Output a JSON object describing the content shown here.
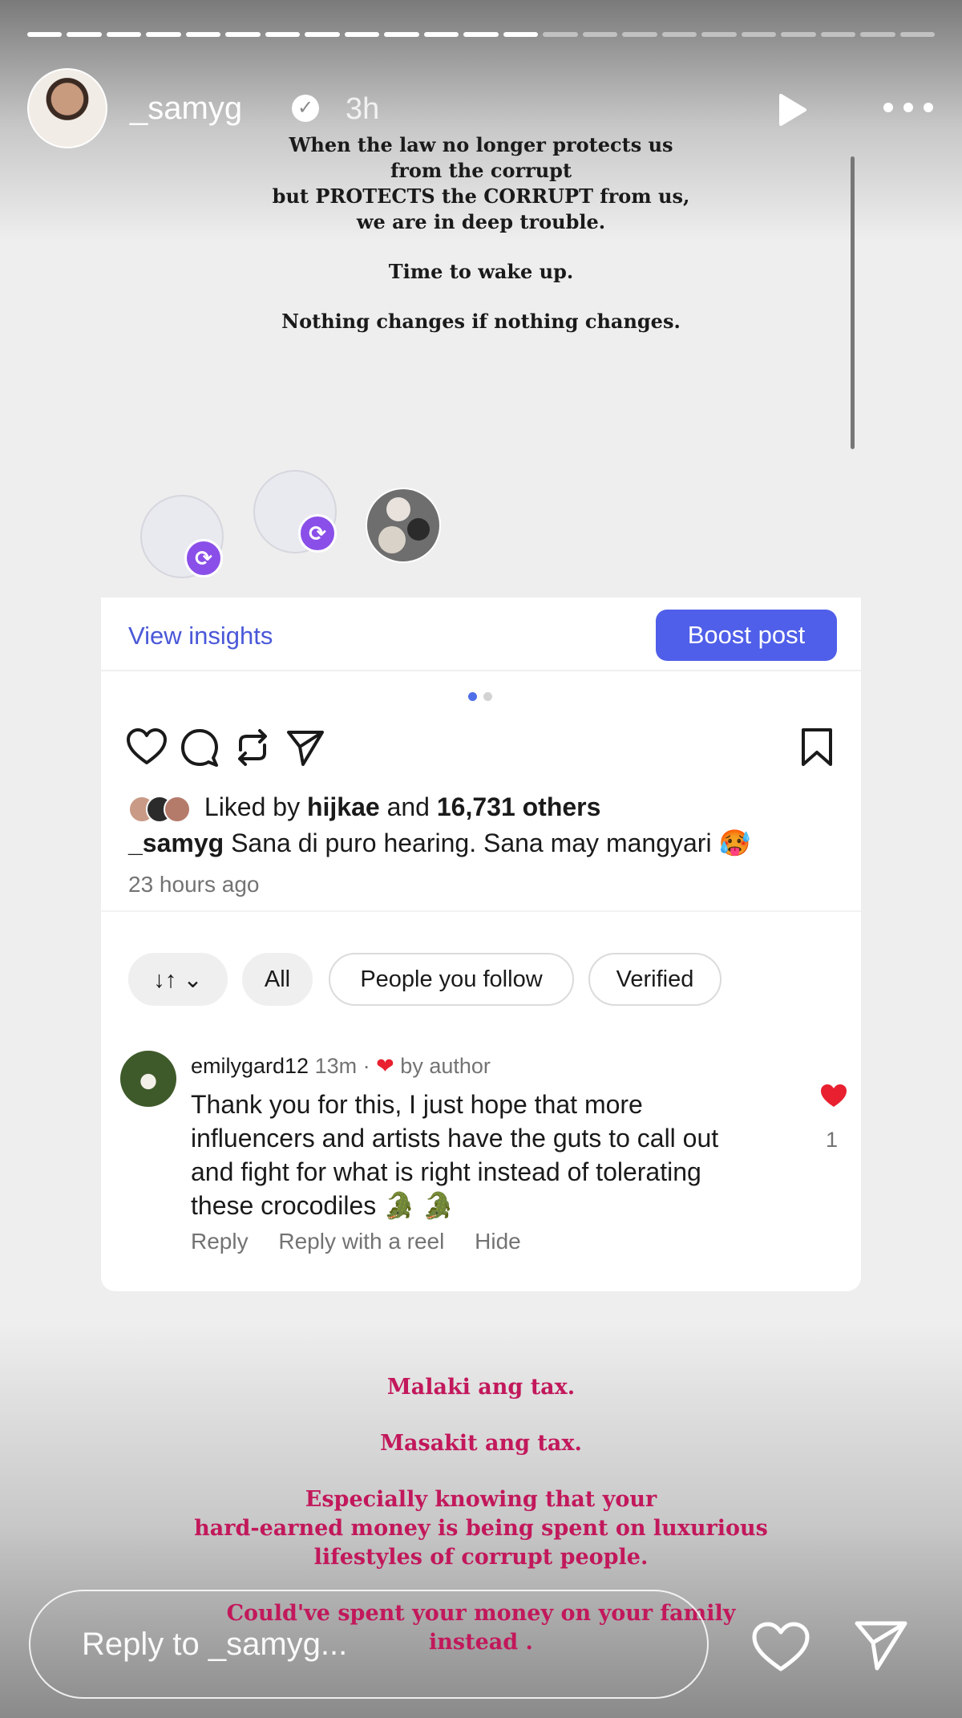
{
  "story": {
    "username": "_samyg",
    "verified_mark": "✓",
    "time": "3h",
    "progress": {
      "total_segments": 23,
      "completed_segments": 13
    }
  },
  "quote_top": {
    "lines_1": [
      "When the law no longer protects us",
      "from the corrupt",
      "but PROTECTS the CORRUPT from us,",
      "we are in deep trouble."
    ],
    "line_2": "Time to wake up.",
    "line_3": "Nothing changes if nothing changes."
  },
  "post": {
    "view_insights": "View insights",
    "boost_post": "Boost post",
    "likes": {
      "prefix": "Liked by",
      "user": "hijkae",
      "and": "and",
      "others": "16,731 others"
    },
    "caption_user": "_samyg",
    "caption_text": "Sana di puro hearing. Sana may mangyari 🥵",
    "posted": "23 hours ago",
    "sort_glyph": "↓↑ ⌄",
    "filters": [
      "All",
      "People you follow",
      "Verified"
    ],
    "comment": {
      "user": "emilygard12",
      "time": "13m",
      "separator": "·",
      "heart_glyph": "❤",
      "liked_by": "by author",
      "text": "Thank you for this, I just hope that more influencers and artists have the guts to call out and fight for what is right instead of tolerating these crocodiles 🐊 🐊",
      "like_count": "1",
      "actions": [
        "Reply",
        "Reply with a reel",
        "Hide"
      ]
    }
  },
  "quote_bottom": {
    "line_1": "Malaki ang tax.",
    "line_2": "Masakit ang tax.",
    "line_3": [
      "Especially knowing that your",
      "hard-earned money is being spent on luxurious",
      "lifestyles of corrupt people."
    ],
    "line_4": [
      "Could've spent your money on your family",
      "instead ."
    ]
  },
  "reply": {
    "placeholder": "Reply to _samyg..."
  },
  "colors": {
    "accent": "#4f5fe9",
    "link": "#4a58d8",
    "sync_badge": "#8a4fe8",
    "quote_pink": "#c2185b",
    "like_red": "#e8202f"
  },
  "icons": [
    "play-icon",
    "more-icon",
    "verified-icon",
    "heart-icon",
    "comment-icon",
    "repost-icon",
    "share-icon",
    "bookmark-icon",
    "sync-icon",
    "send-icon"
  ]
}
